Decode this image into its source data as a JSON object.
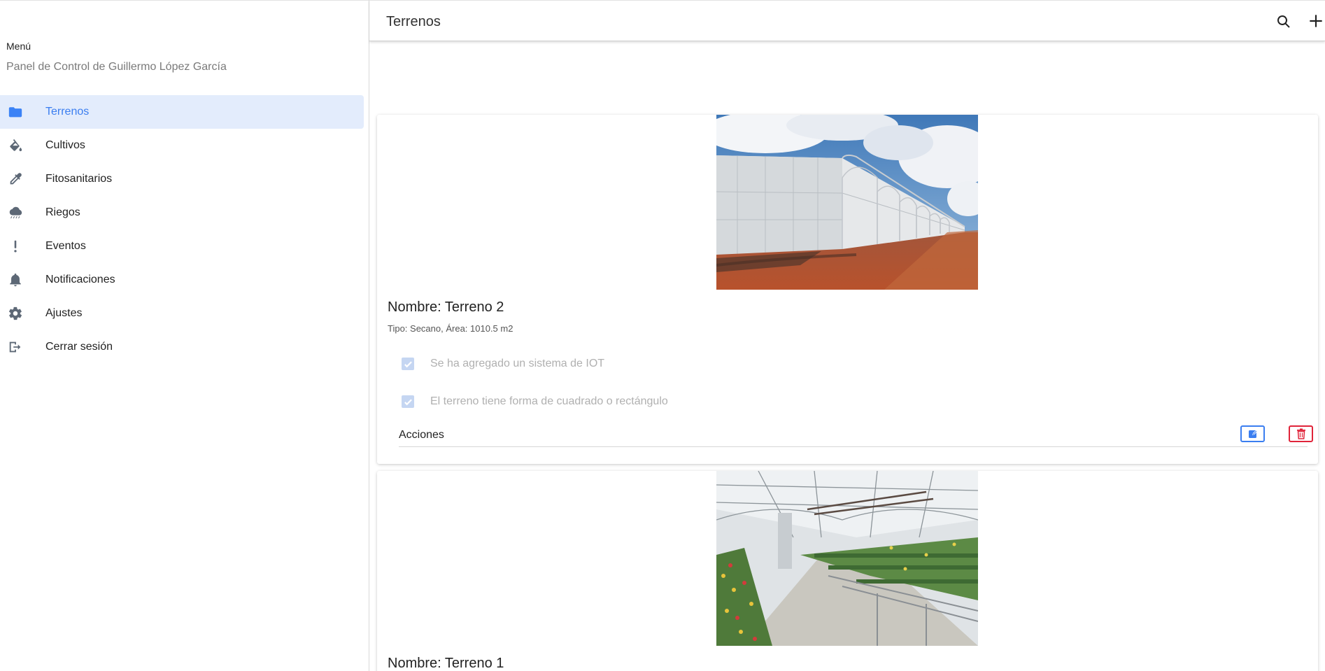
{
  "sidebar": {
    "menu_title": "Menú",
    "subtitle": "Panel de Control de Guillermo López García",
    "items": [
      {
        "label": "Terrenos",
        "icon": "folder-icon",
        "active": true
      },
      {
        "label": "Cultivos",
        "icon": "paint-bucket-icon",
        "active": false
      },
      {
        "label": "Fitosanitarios",
        "icon": "eyedropper-icon",
        "active": false
      },
      {
        "label": "Riegos",
        "icon": "cloud-rain-icon",
        "active": false
      },
      {
        "label": "Eventos",
        "icon": "exclamation-icon",
        "active": false
      },
      {
        "label": "Notificaciones",
        "icon": "bell-icon",
        "active": false
      },
      {
        "label": "Ajustes",
        "icon": "gear-icon",
        "active": false
      },
      {
        "label": "Cerrar sesión",
        "icon": "logout-icon",
        "active": false
      }
    ]
  },
  "header": {
    "title": "Terrenos",
    "search_icon": "search-icon",
    "add_icon": "plus-icon"
  },
  "terrenos": [
    {
      "name": "Nombre: Terreno 2",
      "meta": "Tipo: Secano, Área: 1010.5 m2",
      "checks": [
        {
          "label": "Se ha agregado un sistema de IOT",
          "checked": true
        },
        {
          "label": "El terreno tiene forma de cuadrado o rectángulo",
          "checked": true
        }
      ],
      "actions_label": "Acciones",
      "image": "greenhouse-exterior"
    },
    {
      "name": "Nombre: Terreno 1",
      "image": "greenhouse-interior"
    }
  ],
  "colors": {
    "accent": "#3b7ef0",
    "active_bg": "#e3ecfc",
    "danger": "#e0243a"
  }
}
